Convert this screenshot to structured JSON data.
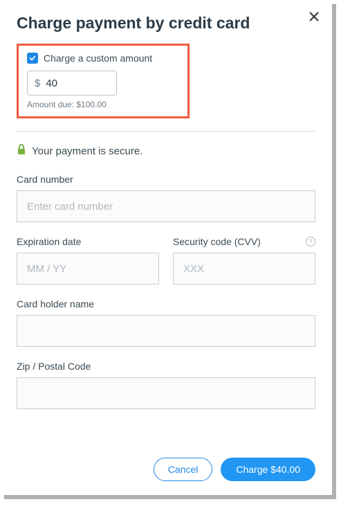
{
  "modal": {
    "title": "Charge payment by credit card",
    "custom_amount": {
      "checkbox_label": "Charge a custom amount",
      "checked": true,
      "currency_symbol": "$",
      "value": "40",
      "amount_due_text": "Amount due: $100.00"
    },
    "secure_text": "Your payment is secure.",
    "fields": {
      "card_number": {
        "label": "Card number",
        "placeholder": "Enter card number"
      },
      "expiration": {
        "label": "Expiration date",
        "placeholder": "MM / YY"
      },
      "cvv": {
        "label": "Security code (CVV)",
        "placeholder": "XXX"
      },
      "card_holder": {
        "label": "Card holder name",
        "placeholder": ""
      },
      "zip": {
        "label": "Zip / Postal Code",
        "placeholder": ""
      }
    },
    "footer": {
      "cancel_label": "Cancel",
      "charge_label": "Charge $40.00"
    }
  }
}
